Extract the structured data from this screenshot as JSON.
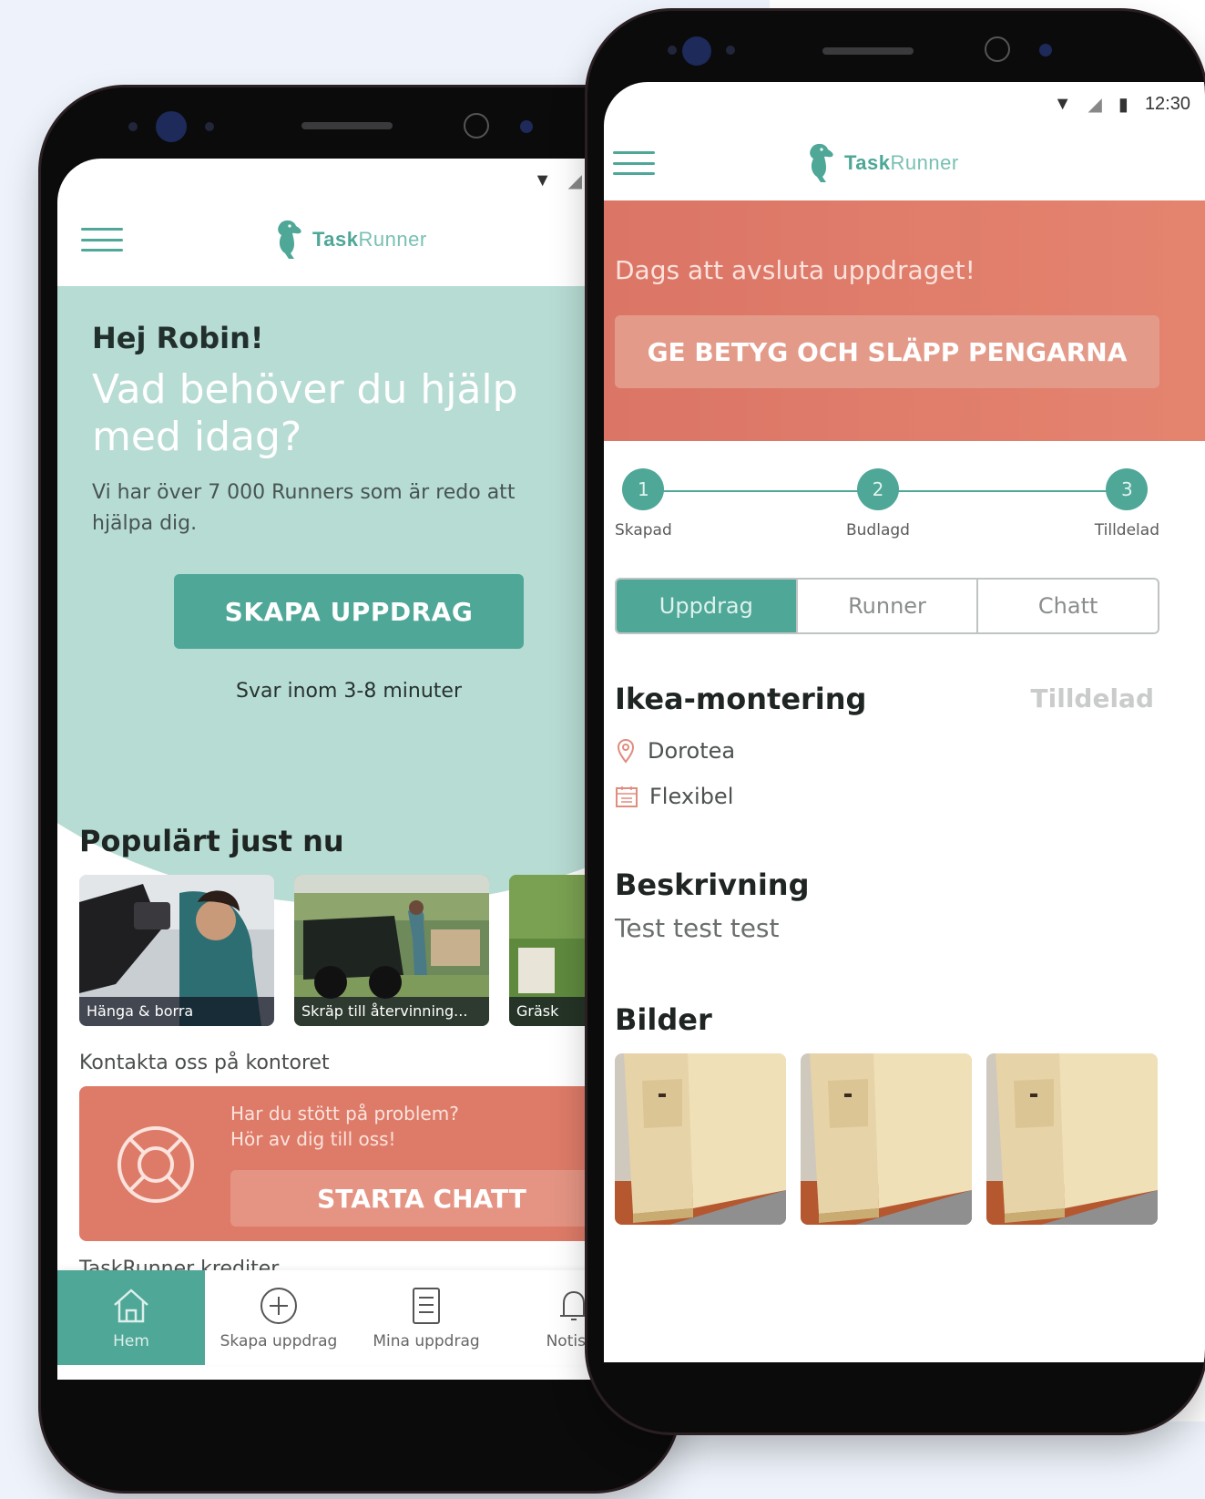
{
  "left_phone": {
    "status": {
      "icons": [
        "wifi-icon",
        "signal-icon",
        "battery-icon"
      ]
    },
    "header": {
      "logo_bold": "Task",
      "logo_light": "Runner"
    },
    "hero": {
      "greeting": "Hej Robin!",
      "title": "Vad behöver du hjälp med idag?",
      "subtitle": "Vi har över 7 000 Runners som är redo att hjälpa dig.",
      "cta_label": "SKAPA UPPDRAG",
      "reply_time": "Svar inom 3-8 minuter"
    },
    "popular": {
      "title": "Populärt just nu",
      "cards": [
        {
          "label": "Hänga & borra"
        },
        {
          "label": "Skräp till återvinning..."
        },
        {
          "label": "Gräsk"
        }
      ]
    },
    "contact": {
      "label": "Kontakta oss på kontoret",
      "help_line1": "Har du stött på problem?",
      "help_line2": "Hör av dig till oss!",
      "chat_label": "STARTA CHATT"
    },
    "credits_label": "TaskRunner krediter",
    "bottom_nav": [
      {
        "label": "Hem",
        "icon": "home-icon"
      },
      {
        "label": "Skapa uppdrag",
        "icon": "plus-circle-icon"
      },
      {
        "label": "Mina uppdrag",
        "icon": "clipboard-icon"
      },
      {
        "label": "Notiser",
        "icon": "bell-icon"
      }
    ]
  },
  "right_phone": {
    "status": {
      "time": "12:30"
    },
    "header": {
      "logo_bold": "Task",
      "logo_light": "Runner"
    },
    "alert": {
      "text": "Dags att avsluta uppdraget!",
      "cta_label": "GE BETYG OCH SLÄPP PENGARNA"
    },
    "steps": [
      {
        "num": "1",
        "label": "Skapad"
      },
      {
        "num": "2",
        "label": "Budlagd"
      },
      {
        "num": "3",
        "label": "Tilldelad"
      }
    ],
    "tabs": [
      "Uppdrag",
      "Runner",
      "Chatt"
    ],
    "task": {
      "title": "Ikea-montering",
      "status": "Tilldelad",
      "location": "Dorotea",
      "when": "Flexibel"
    },
    "description": {
      "heading": "Beskrivning",
      "text": "Test test test"
    },
    "images": {
      "heading": "Bilder",
      "count": 3
    }
  },
  "colors": {
    "brand_teal": "#4ea797",
    "hero_mint": "#b7dcd3",
    "coral": "#de7b68",
    "background": "#eef3fb"
  }
}
